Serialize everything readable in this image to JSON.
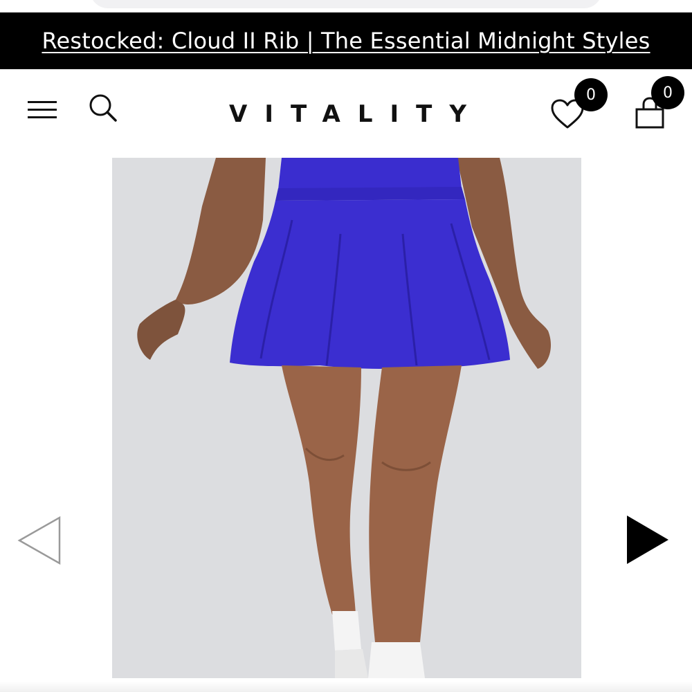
{
  "promo": {
    "text": "Restocked: Cloud II Rib | The Essential Midnight Styles"
  },
  "header": {
    "menu_icon": "hamburger-menu-icon",
    "search_icon": "search-icon",
    "logo": "VITALITY",
    "wishlist_icon": "heart-icon",
    "wishlist_count": "0",
    "cart_icon": "shopping-bag-icon",
    "cart_count": "0"
  },
  "gallery": {
    "image_subject": "Blue flared skort product photo",
    "prev_icon": "triangle-left-outline-icon",
    "next_icon": "triangle-right-filled-icon"
  },
  "colors": {
    "banner_bg": "#000000",
    "banner_text": "#ffffff",
    "product_blue": "#3b2ed0",
    "photo_bg": "#dcdde0"
  }
}
